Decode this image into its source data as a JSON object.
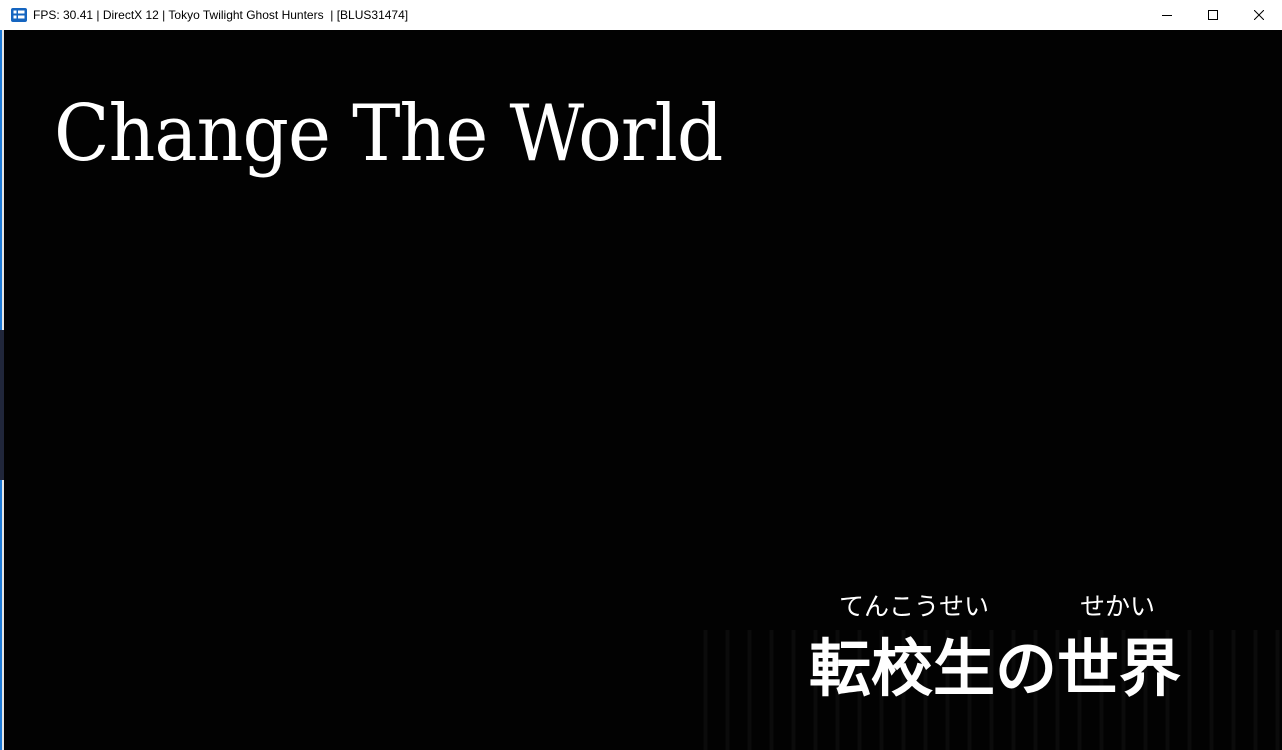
{
  "window": {
    "title": "FPS: 30.41 | DirectX 12 | Tokyo Twilight Ghost Hunters  | [BLUS31474]",
    "app_icon": "rpcs3-app-icon",
    "controls": {
      "minimize_icon": "minimize-icon",
      "maximize_icon": "maximize-icon",
      "close_icon": "close-icon"
    }
  },
  "game": {
    "title_english": "Change The World",
    "ruby_left": "てんこうせい",
    "ruby_right": "せかい",
    "title_japanese": "転校生の世界",
    "colors": {
      "background": "#020202",
      "text": "#ffffff"
    }
  }
}
